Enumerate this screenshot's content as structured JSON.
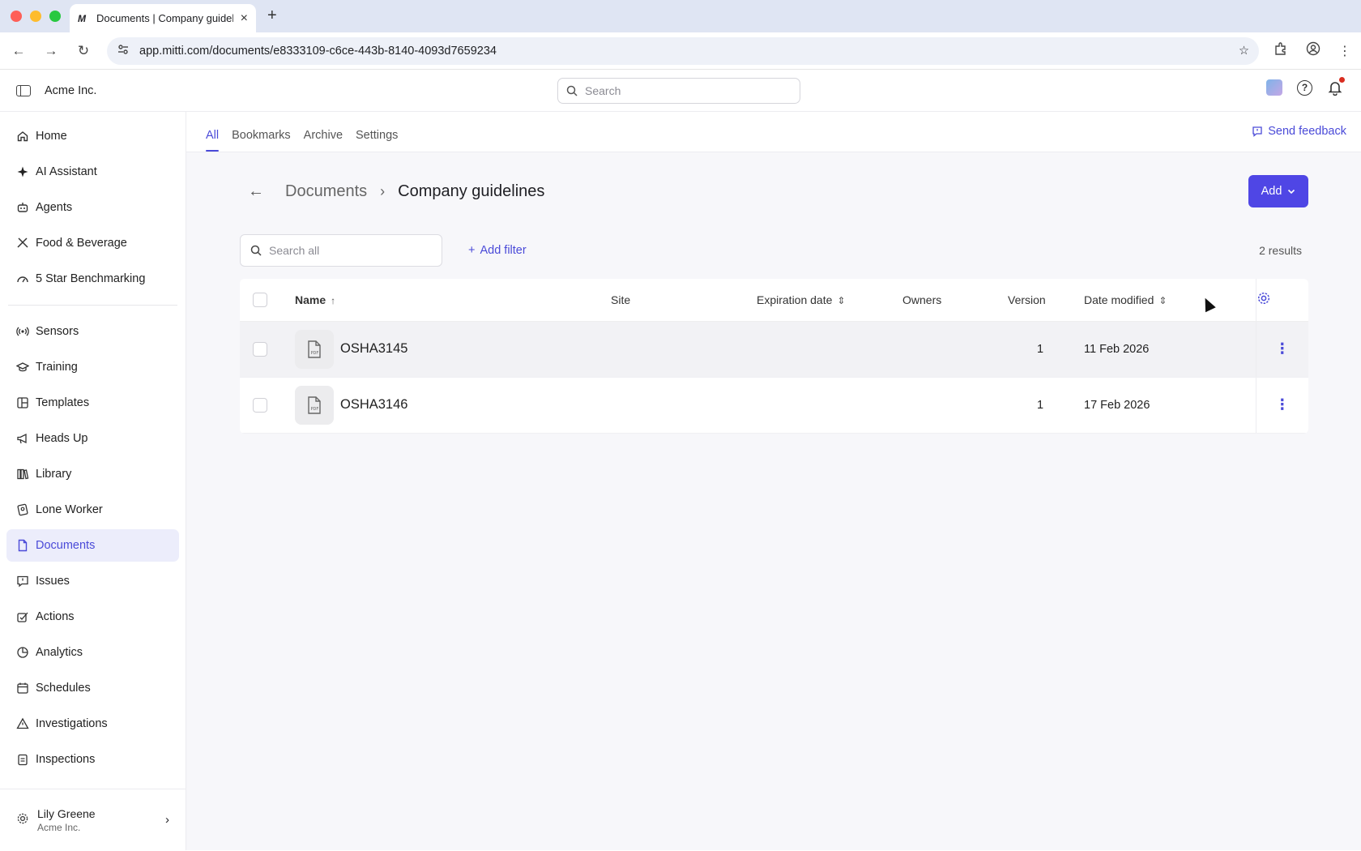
{
  "browser": {
    "tab_title": "Documents | Company guidel",
    "tab_favicon": "M",
    "url": "app.mitti.com/documents/e8333109-c6ce-443b-8140-4093d7659234"
  },
  "header": {
    "org_name": "Acme Inc.",
    "search_placeholder": "Search"
  },
  "sidebar": {
    "group1": [
      {
        "label": "Home",
        "icon": "home-icon"
      },
      {
        "label": "AI Assistant",
        "icon": "sparkle-icon"
      },
      {
        "label": "Agents",
        "icon": "robot-icon"
      },
      {
        "label": "Food & Beverage",
        "icon": "utensils-icon"
      },
      {
        "label": "5 Star Benchmarking",
        "icon": "gauge-icon"
      }
    ],
    "group2": [
      {
        "label": "Sensors",
        "icon": "broadcast-icon"
      },
      {
        "label": "Training",
        "icon": "graduation-cap-icon"
      },
      {
        "label": "Templates",
        "icon": "layout-icon"
      },
      {
        "label": "Heads Up",
        "icon": "megaphone-icon"
      },
      {
        "label": "Library",
        "icon": "books-icon"
      },
      {
        "label": "Lone Worker",
        "icon": "id-badge-icon"
      },
      {
        "label": "Documents",
        "icon": "document-icon",
        "active": true
      },
      {
        "label": "Issues",
        "icon": "alert-bubble-icon"
      },
      {
        "label": "Actions",
        "icon": "check-square-icon"
      },
      {
        "label": "Analytics",
        "icon": "pie-chart-icon"
      },
      {
        "label": "Schedules",
        "icon": "calendar-icon"
      },
      {
        "label": "Investigations",
        "icon": "warning-triangle-icon"
      },
      {
        "label": "Inspections",
        "icon": "clipboard-icon"
      }
    ],
    "user": {
      "name": "Lily Greene",
      "org": "Acme Inc."
    }
  },
  "subtabs": [
    "All",
    "Bookmarks",
    "Archive",
    "Settings"
  ],
  "feedback_label": "Send feedback",
  "breadcrumb": {
    "parent": "Documents",
    "current": "Company guidelines"
  },
  "add_button_label": "Add",
  "search_all_placeholder": "Search all",
  "add_filter_label": "Add filter",
  "results_text": "2 results",
  "table": {
    "columns": {
      "name": "Name",
      "site": "Site",
      "expiration": "Expiration date",
      "owners": "Owners",
      "version": "Version",
      "modified": "Date modified"
    },
    "rows": [
      {
        "name": "OSHA3145",
        "site": "",
        "expiration": "",
        "owners": "",
        "version": "1",
        "modified": "11 Feb 2026"
      },
      {
        "name": "OSHA3146",
        "site": "",
        "expiration": "",
        "owners": "",
        "version": "1",
        "modified": "17 Feb 2026"
      }
    ]
  },
  "colors": {
    "accent": "#4f46e5",
    "active_nav_bg": "#ecedfb"
  }
}
